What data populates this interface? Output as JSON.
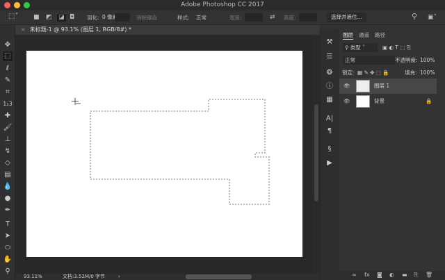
{
  "window": {
    "title": "Adobe Photoshop CC 2017",
    "colors": {
      "close": "#fc605b",
      "minimize": "#fdbc40",
      "maximize": "#34c84a"
    }
  },
  "options": {
    "feather_label": "羽化:",
    "feather_value": "0 像素",
    "antialias_label": "消除锯齿",
    "style_label": "样式:",
    "style_value": "正常",
    "width_label": "宽度:",
    "height_label": "高度:",
    "select_mask_button": "选择并遮住..."
  },
  "document": {
    "tab_title": "未标题-1 @ 93.1% (图层 1, RGB/8#) *"
  },
  "status": {
    "zoom": "93.11%",
    "doc_info": "文档:3.52M/0 字节"
  },
  "layers_panel": {
    "tabs": [
      "图层",
      "通道",
      "路径"
    ],
    "filter": "类型",
    "blend_mode": "正常",
    "opacity_label": "不透明度:",
    "opacity": "100%",
    "lock_label": "锁定:",
    "fill_label": "填充:",
    "fill": "100%",
    "layers": [
      {
        "name": "图层 1",
        "visible": true,
        "selected": true
      },
      {
        "name": "背景",
        "visible": true,
        "locked": true
      }
    ]
  }
}
